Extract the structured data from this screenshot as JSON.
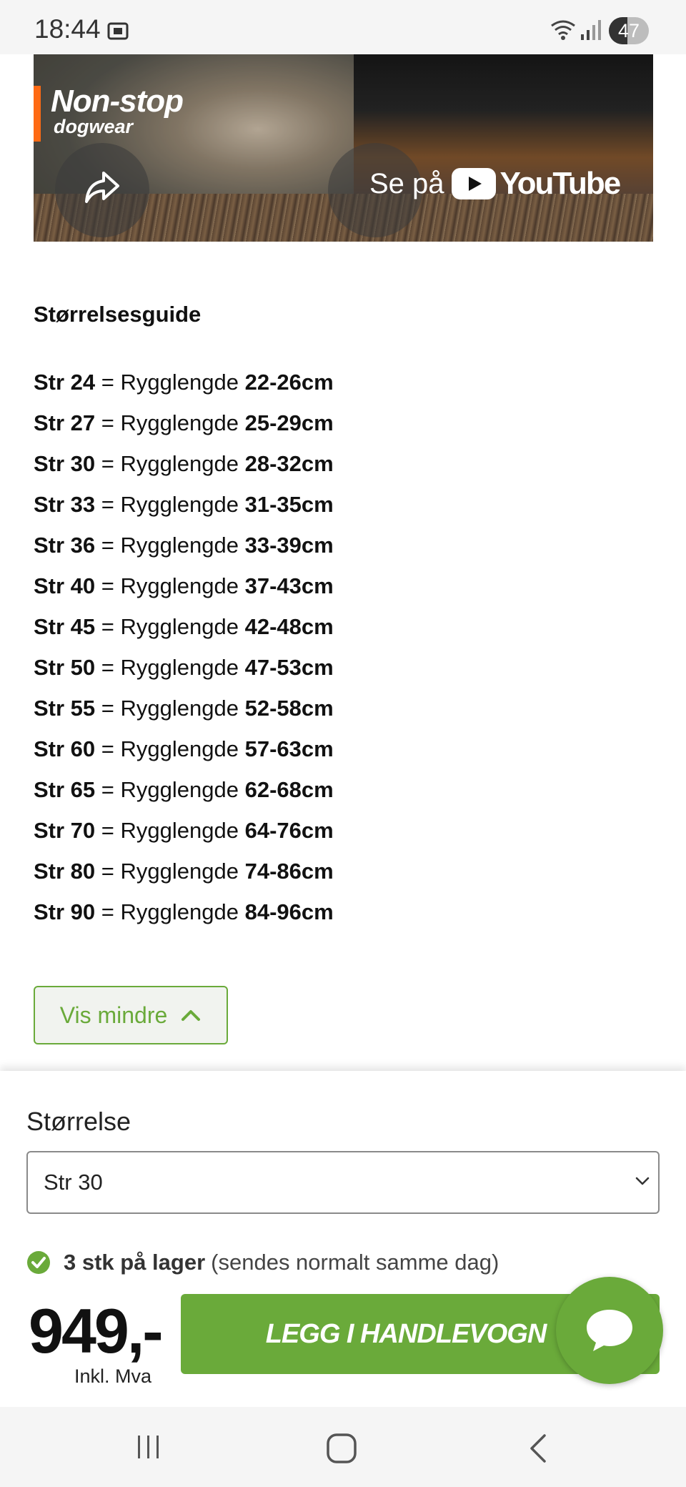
{
  "status_bar": {
    "time": "18:44",
    "battery": "47",
    "battery_level": 0.47
  },
  "video": {
    "brand_line1": "Non-stop",
    "brand_line2": "dogwear",
    "watch_label": "Se på",
    "youtube_label": "YouTube"
  },
  "size_guide": {
    "title": "Størrelsesguide",
    "separator": " = ",
    "label": "Rygglengde",
    "rows": [
      {
        "size": "Str 24",
        "range": "22-26cm"
      },
      {
        "size": "Str 27",
        "range": "25-29cm"
      },
      {
        "size": "Str 30",
        "range": "28-32cm"
      },
      {
        "size": "Str 33",
        "range": "31-35cm"
      },
      {
        "size": "Str 36",
        "range": "33-39cm"
      },
      {
        "size": "Str 40",
        "range": "37-43cm"
      },
      {
        "size": "Str 45",
        "range": "42-48cm"
      },
      {
        "size": "Str 50",
        "range": "47-53cm"
      },
      {
        "size": "Str 55",
        "range": "52-58cm"
      },
      {
        "size": "Str 60",
        "range": "57-63cm"
      },
      {
        "size": "Str 65",
        "range": "62-68cm"
      },
      {
        "size": "Str 70",
        "range": "64-76cm"
      },
      {
        "size": "Str 80",
        "range": "74-86cm"
      },
      {
        "size": "Str 90",
        "range": "84-96cm"
      }
    ]
  },
  "toggle": {
    "label": "Vis mindre"
  },
  "purchase": {
    "size_label": "Størrelse",
    "selected_size": "Str 30",
    "stock_bold": "3 stk på lager",
    "stock_note": "(sendes normalt samme dag)",
    "price": "949,-",
    "vat_note": "Inkl. Mva",
    "cart_button": "LEGG I HANDLEVOGN"
  },
  "colors": {
    "accent": "#6aaa3a",
    "brand_orange": "#ff6a13"
  },
  "icons": {
    "share": "share-icon",
    "chat": "chat-icon",
    "check": "check-circle-icon",
    "chevron_up": "chevron-up-icon",
    "chevron_down": "chevron-down-icon",
    "nav_recents": "recents-icon",
    "nav_home": "home-icon",
    "nav_back": "back-icon"
  }
}
